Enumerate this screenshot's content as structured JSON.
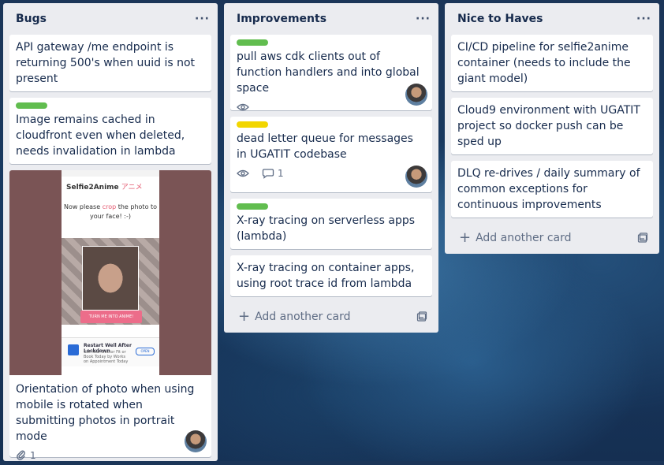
{
  "lists": [
    {
      "title": "Bugs",
      "cards": [
        {
          "title": "API gateway /me endpoint is returning 500's when uuid is not present"
        },
        {
          "title": "Image remains cached in cloudfront even when deleted, needs invalidation in lambda",
          "label": "green"
        },
        {
          "title": "Orientation of photo when using mobile is rotated when submitting photos in portrait mode",
          "attachments": "1",
          "cover": {
            "app_name": "Selfie2Anime",
            "app_name_jp": "アニメ",
            "prompt_line1": "Now please ",
            "prompt_crop": "crop",
            "prompt_line1_end": " the photo to",
            "prompt_line2": "your face! :-)",
            "button": "TURN ME INTO ANIME!",
            "ad_title": "Restart Well After Lockdown",
            "ad_subtitle": "Get Your Doctor Fit or Book Today by Works on Appointment Today",
            "ad_open": "OPEN"
          }
        }
      ]
    },
    {
      "title": "Improvements",
      "cards": [
        {
          "title": "pull aws cdk clients out of function handlers and into global space",
          "label": "green"
        },
        {
          "title": "dead letter queue for messages in UGATIT codebase",
          "label": "yellow",
          "comments": "1"
        },
        {
          "title": "X-ray tracing on serverless apps (lambda)",
          "label": "green"
        },
        {
          "title": "X-ray tracing on container apps, using root trace id from lambda"
        }
      ],
      "add_card": "Add another card"
    },
    {
      "title": "Nice to Haves",
      "cards": [
        {
          "title": "CI/CD pipeline for selfie2anime container (needs to include the giant model)"
        },
        {
          "title": "Cloud9 environment with UGATIT project so docker push can be sped up"
        },
        {
          "title": "DLQ re-drives / daily summary of common exceptions for continuous improvements"
        }
      ],
      "add_card": "Add another card"
    }
  ],
  "list_menu_glyph": "···",
  "colors": {
    "label_green": "#61bd4f",
    "label_yellow": "#f2d600",
    "list_bg": "#ebecf0"
  }
}
